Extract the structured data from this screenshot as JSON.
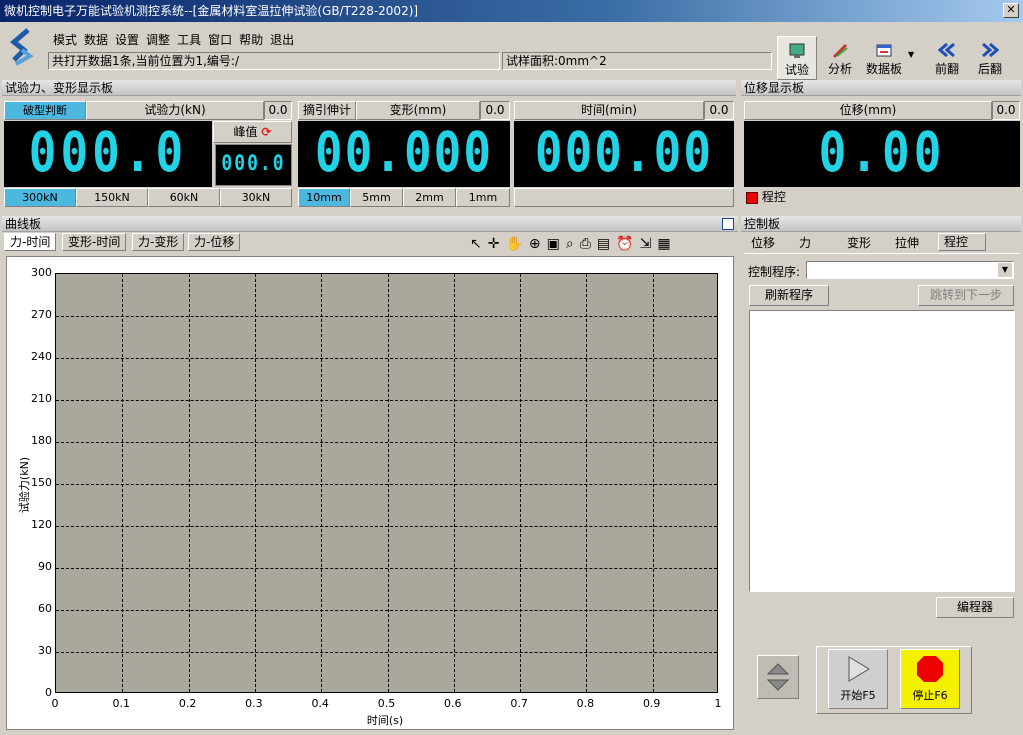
{
  "window": {
    "title": "微机控制电子万能试验机测控系统--[金属材料室温拉伸试验(GB/T228-2002)]",
    "close": "✕"
  },
  "menu": [
    "模式",
    "数据",
    "设置",
    "调整",
    "工具",
    "窗口",
    "帮助",
    "退出"
  ],
  "status": {
    "left": "共打开数据1条,当前位置为1,编号:/",
    "right": "试样面积:0mm^2"
  },
  "toolbar": [
    {
      "label": "试验",
      "icon": "test-icon"
    },
    {
      "label": "分析",
      "icon": "analyze-icon"
    },
    {
      "label": "数据板",
      "icon": "databoard-icon"
    },
    {
      "label": "前翻",
      "icon": "prev-icon"
    },
    {
      "label": "后翻",
      "icon": "next-icon"
    }
  ],
  "force_panel": {
    "title": "试验力、变形显示板",
    "break_btn": "破型判断",
    "force_header": "试验力(kN)",
    "force_small": "0.0",
    "force_value": "000.0",
    "peak_label": "峰值",
    "peak_value": "000.0",
    "ranges": [
      "300kN",
      "150kN",
      "60kN",
      "30kN"
    ],
    "extensometer_btn": "摘引伸计",
    "deform_header": "变形(mm)",
    "deform_small": "0.0",
    "deform_value": "00.000",
    "deform_ranges": [
      "10mm",
      "5mm",
      "2mm",
      "1mm"
    ],
    "time_header": "时间(min)",
    "time_small": "0.0",
    "time_value": "000.00"
  },
  "disp_panel": {
    "title": "位移显示板",
    "header": "位移(mm)",
    "small": "0.0",
    "value": "0.00",
    "prog_label": "程控"
  },
  "curve_panel": {
    "title": "曲线板",
    "tabs": [
      "力-时间",
      "变形-时间",
      "力-变形",
      "力-位移"
    ]
  },
  "chart_data": {
    "type": "line",
    "xlabel": "时间(s)",
    "ylabel": "试验力(kN)",
    "xlim": [
      0,
      1
    ],
    "ylim": [
      0,
      300
    ],
    "xticks": [
      "0",
      "0.1",
      "0.2",
      "0.3",
      "0.4",
      "0.5",
      "0.6",
      "0.7",
      "0.8",
      "0.9",
      "1"
    ],
    "yticks": [
      "300",
      "270",
      "240",
      "210",
      "180",
      "150",
      "120",
      "90",
      "60",
      "30",
      "0"
    ],
    "grid": true,
    "series": [],
    "plot_bg": "#aaa89d"
  },
  "control": {
    "title": "控制板",
    "tabs": [
      "位移",
      "力",
      "变形",
      "拉伸",
      "程控"
    ],
    "program_label": "控制程序:",
    "refresh_btn": "刷新程序",
    "jump_btn": "跳转到下一步",
    "editor_btn": "编程器",
    "start_btn": "开始F5",
    "stop_btn": "停止F6"
  }
}
